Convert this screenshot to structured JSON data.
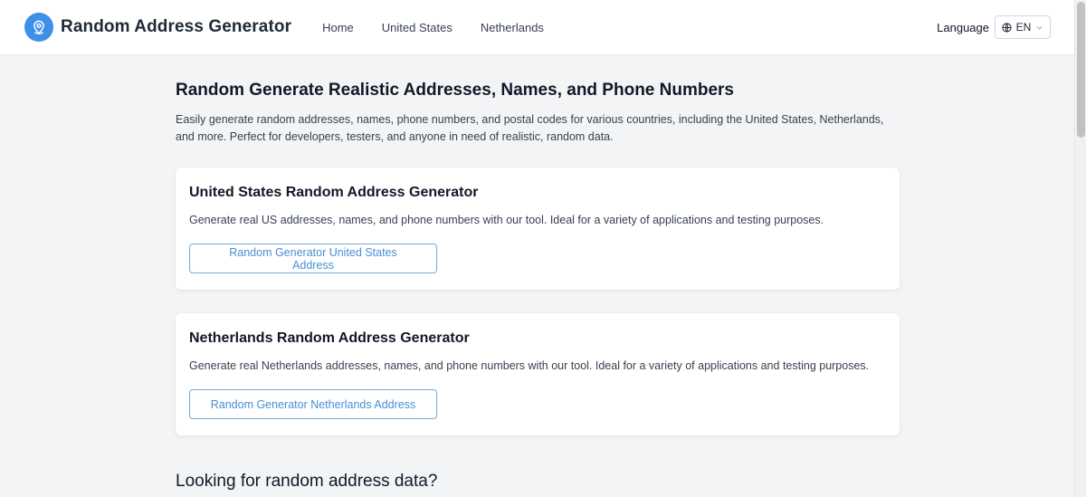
{
  "header": {
    "brand": "Random Address Generator",
    "logo_icon": "map-pin-icon",
    "nav": [
      {
        "label": "Home"
      },
      {
        "label": "United States"
      },
      {
        "label": "Netherlands"
      }
    ],
    "language_label": "Language",
    "language_value": "EN"
  },
  "main": {
    "title": "Random Generate Realistic Addresses, Names, and Phone Numbers",
    "description": "Easily generate random addresses, names, phone numbers, and postal codes for various countries, including the United States, Netherlands, and more. Perfect for developers, testers, and anyone in need of realistic, random data.",
    "cards": [
      {
        "title": "United States Random Address Generator",
        "description": "Generate real US addresses, names, and phone numbers with our tool. Ideal for a variety of applications and testing purposes.",
        "button": "Random Generator United States Address"
      },
      {
        "title": "Netherlands Random Address Generator",
        "description": "Generate real Netherlands addresses, names, and phone numbers with our tool. Ideal for a variety of applications and testing purposes.",
        "button": "Random Generator Netherlands Address"
      }
    ],
    "section_title": "Looking for random address data?"
  },
  "colors": {
    "accent": "#3d8fe8",
    "button_text": "#4a8fd3",
    "background": "#f3f4f6"
  }
}
